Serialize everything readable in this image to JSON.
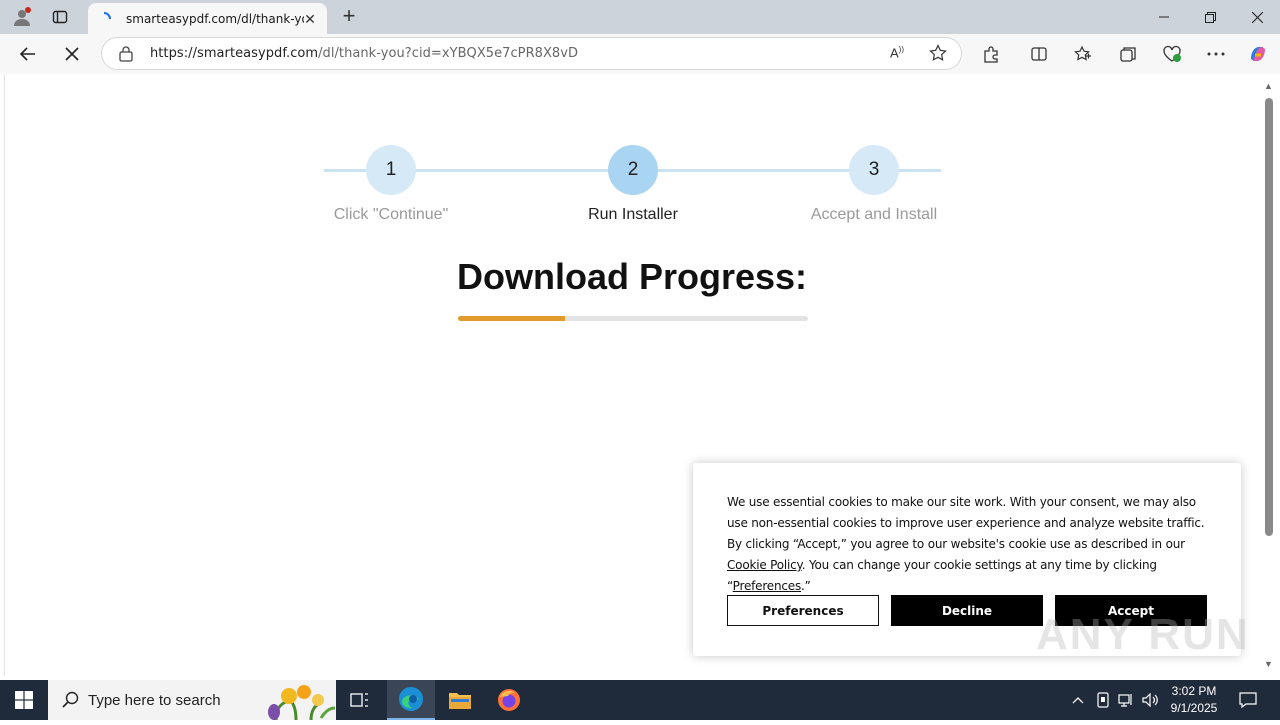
{
  "browser": {
    "tab_title": "smarteasypdf.com/dl/thank-you?c",
    "url_host": "https://smarteasypdf.com",
    "url_path": "/dl/thank-you?cid=xYBQX5e7cPR8X8vD"
  },
  "steps": [
    {
      "number": "1",
      "label": "Click \"Continue\""
    },
    {
      "number": "2",
      "label": "Run Installer"
    },
    {
      "number": "3",
      "label": "Accept and Install"
    }
  ],
  "download": {
    "title": "Download Progress:",
    "progress_percent": 30.5
  },
  "cookie": {
    "text_before": "We use essential cookies to make our site work. With your consent, we may also use non-essential cookies to improve user experience and analyze website traffic. By clicking “Accept,” you agree to our website's cookie use as described in our ",
    "cookie_policy_link": "Cookie Policy",
    "text_middle": ". You can change your cookie settings at any time by clicking “",
    "preferences_link": "Preferences",
    "text_after": ".”",
    "preferences_button": "Preferences",
    "decline_button": "Decline",
    "accept_button": "Accept"
  },
  "watermark": "ANY RUN",
  "taskbar": {
    "search_placeholder": "Type here to search",
    "time": "3:02 PM",
    "date": "9/1/2025"
  },
  "colors": {
    "progress": "#e19a2b",
    "step_active": "#a9d4f2",
    "step": "#d5e9f7"
  }
}
